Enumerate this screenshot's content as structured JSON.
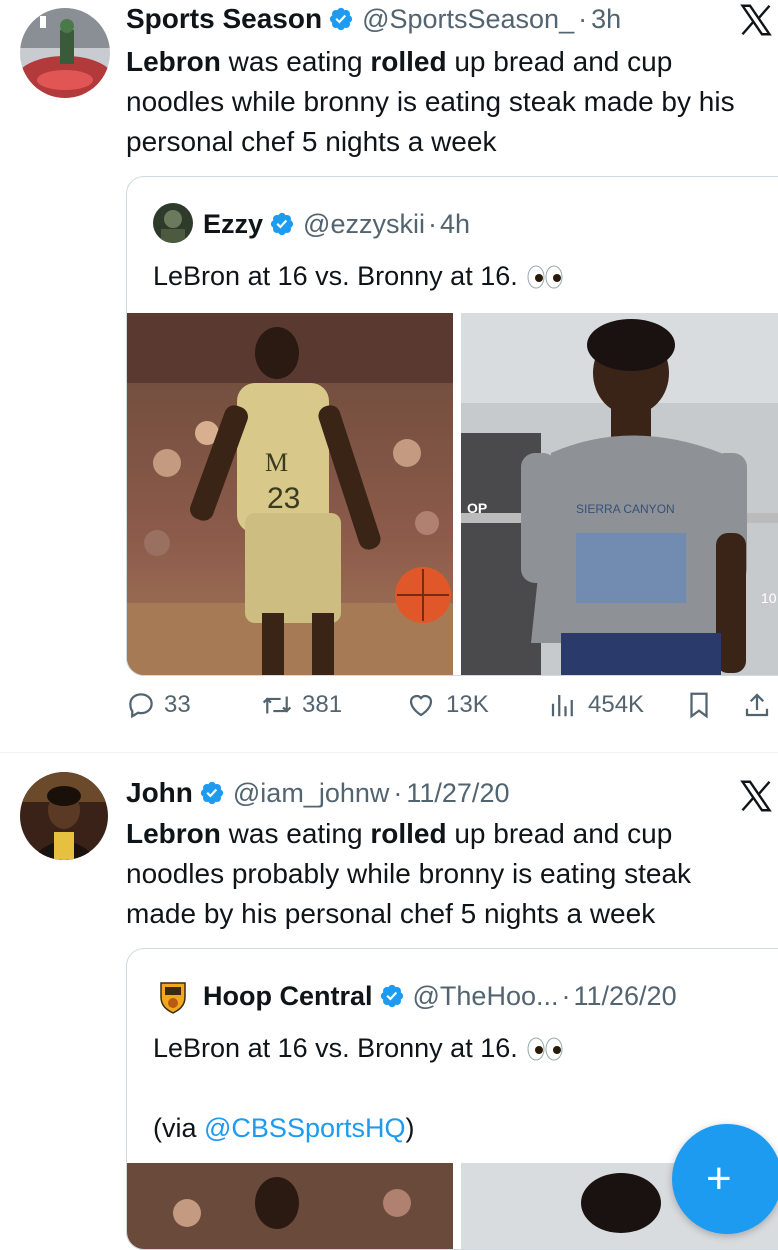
{
  "tweet1": {
    "name": "Sports Season",
    "handle": "@SportsSeason_",
    "time": "3h",
    "text": {
      "w1": "Lebron",
      "t1": " was eating ",
      "w2": "rolled",
      "t2": " up bread and cup noodles while bronny is eating steak made by his personal chef 5 nights a week"
    },
    "quote": {
      "name": "Ezzy",
      "handle": "@ezzyskii",
      "time": "4h",
      "text": "LeBron at 16 vs. Bronny at 16."
    },
    "actions": {
      "replies": "33",
      "reposts": "381",
      "likes": "13K",
      "views": "454K"
    }
  },
  "tweet2": {
    "name": "John",
    "handle": "@iam_johnw",
    "time": "11/27/20",
    "text": {
      "w1": "Lebron",
      "t1": " was eating ",
      "w2": "rolled",
      "t2": " up bread and cup noodles probably while bronny is eating steak made by his personal chef 5 nights a week"
    },
    "quote": {
      "name": "Hoop Central",
      "handle": "@TheHoo...",
      "time": "11/26/20",
      "text": "LeBron at 16 vs. Bronny at 16.",
      "via_prefix": "(via ",
      "via_link": "@CBSSportsHQ",
      "via_suffix": ")"
    }
  },
  "separator_dot": "·",
  "fab_label": "+",
  "colors": {
    "accent": "#1d9bf0",
    "text": "#0f1419",
    "muted": "#536471",
    "border": "#cfd9de"
  }
}
